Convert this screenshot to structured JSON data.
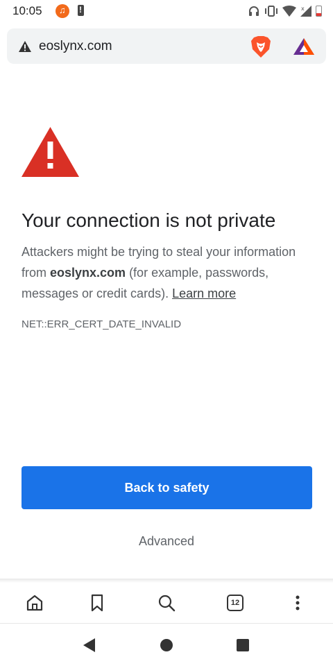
{
  "status_bar": {
    "time": "10:05",
    "icons": [
      "music-notification-icon",
      "battery-alert-icon",
      "headset-icon",
      "vibrate-icon",
      "wifi-icon",
      "signal-icon",
      "battery-icon"
    ]
  },
  "url_bar": {
    "security_icon": "warning-triangle-icon",
    "url": "eoslynx.com",
    "brave_shields_icon": "brave-lion-icon",
    "rewards_icon": "bat-rewards-icon"
  },
  "interstitial": {
    "icon": "large-warning-triangle-icon",
    "title": "Your connection is not private",
    "desc_part1": "Attackers might be trying to steal your information from ",
    "desc_domain": "eoslynx.com",
    "desc_part2": " (for example, passwords, messages or credit cards). ",
    "learn_more": "Learn more",
    "error_code": "NET::ERR_CERT_DATE_INVALID",
    "primary_button": "Back to safety",
    "advanced_button": "Advanced"
  },
  "bottom_toolbar": {
    "tab_count": "12",
    "items": [
      "home-icon",
      "bookmark-icon",
      "search-icon",
      "tab-switcher-icon",
      "more-vert-icon"
    ]
  },
  "system_nav": {
    "items": [
      "back-icon",
      "home-circle-icon",
      "recents-square-icon"
    ]
  },
  "colors": {
    "primary_blue": "#1a73e8",
    "warning_red": "#d93025",
    "url_bar_bg": "#f1f3f4",
    "body_gray": "#5f6368"
  }
}
